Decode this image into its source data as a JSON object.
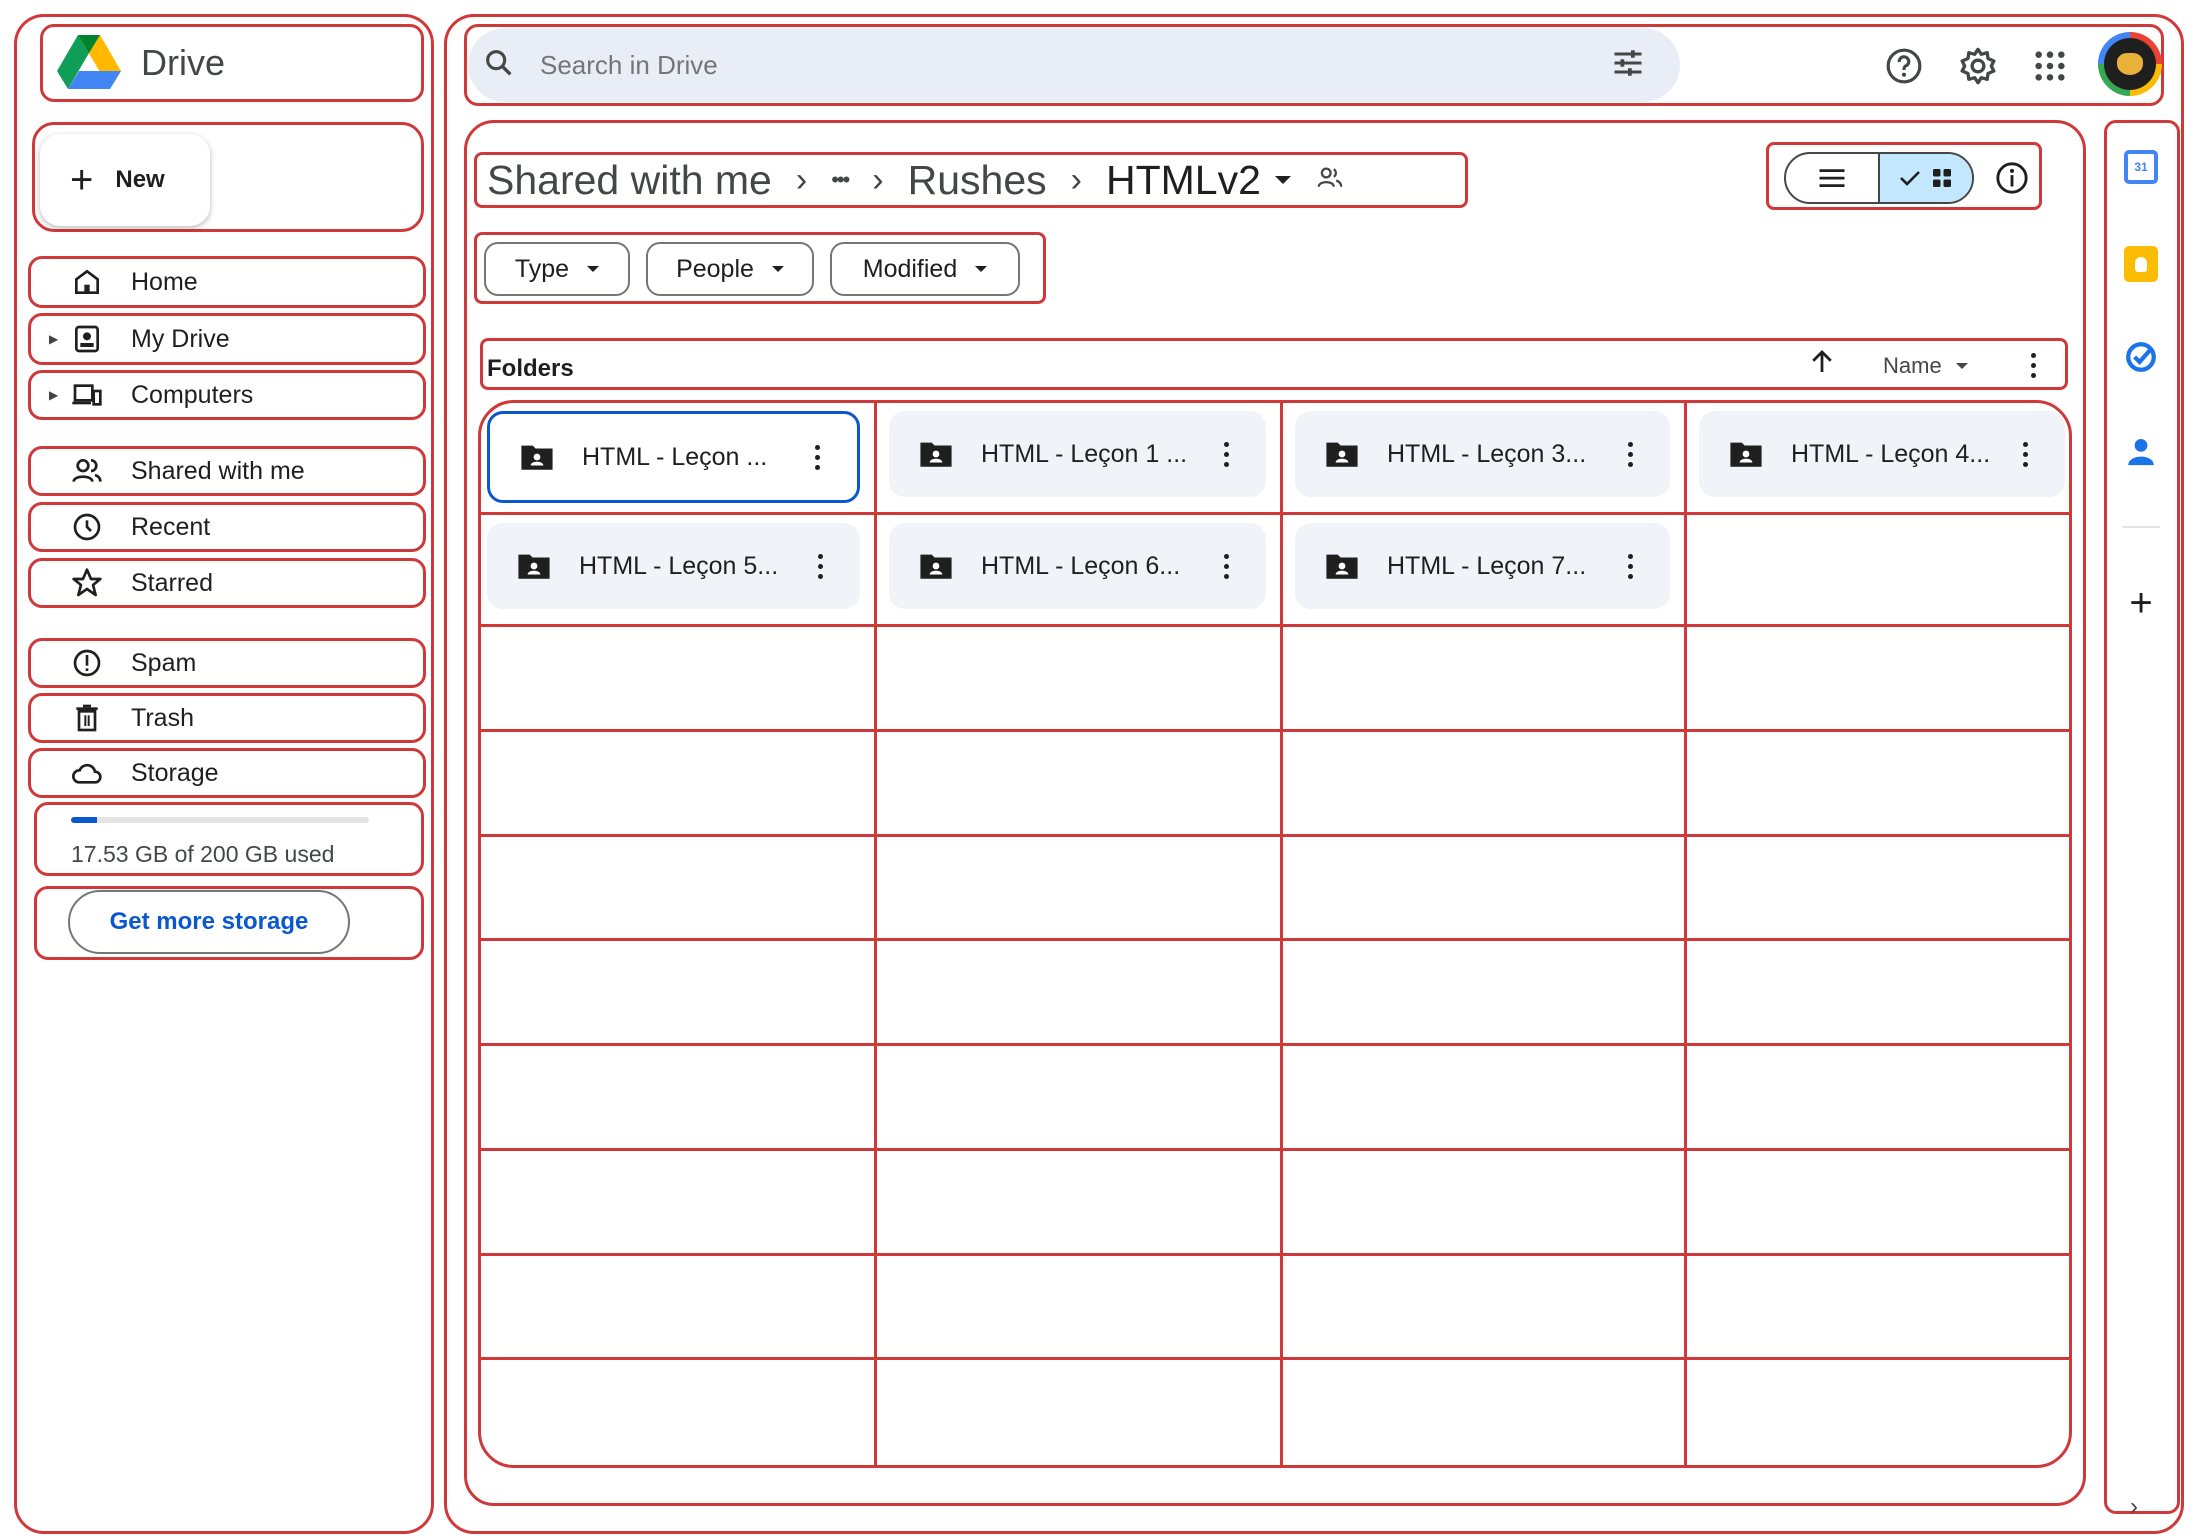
{
  "app": {
    "title": "Drive"
  },
  "sidebar": {
    "new_label": "New",
    "items": [
      {
        "label": "Home",
        "icon": "home-icon"
      },
      {
        "label": "My Drive",
        "icon": "my-drive-icon"
      },
      {
        "label": "Computers",
        "icon": "computers-icon"
      },
      {
        "label": "Shared with me",
        "icon": "shared-icon"
      },
      {
        "label": "Recent",
        "icon": "clock-icon"
      },
      {
        "label": "Starred",
        "icon": "star-icon"
      },
      {
        "label": "Spam",
        "icon": "spam-icon"
      },
      {
        "label": "Trash",
        "icon": "trash-icon"
      },
      {
        "label": "Storage",
        "icon": "cloud-icon"
      }
    ],
    "storage": {
      "used_text": "17.53 GB of 200 GB used",
      "fraction": 0.0877
    },
    "get_more_storage": "Get more storage"
  },
  "search": {
    "placeholder": "Search in Drive"
  },
  "breadcrumb": {
    "root": "Shared with me",
    "ellipsis": "•••",
    "parent": "Rushes",
    "current": "HTMLv2"
  },
  "filters": [
    "Type",
    "People",
    "Modified"
  ],
  "section": {
    "title": "Folders",
    "sort_label": "Name"
  },
  "folders": [
    "HTML - Leçon ...",
    "HTML - Leçon 1 ...",
    "HTML - Leçon 3...",
    "HTML - Leçon 4...",
    "HTML - Leçon 5...",
    "HTML - Leçon 6...",
    "HTML - Leçon 7..."
  ],
  "colors": {
    "accent": "#0b57d0",
    "annotation": "#d0393a",
    "selected_view": "#c2e7ff"
  }
}
